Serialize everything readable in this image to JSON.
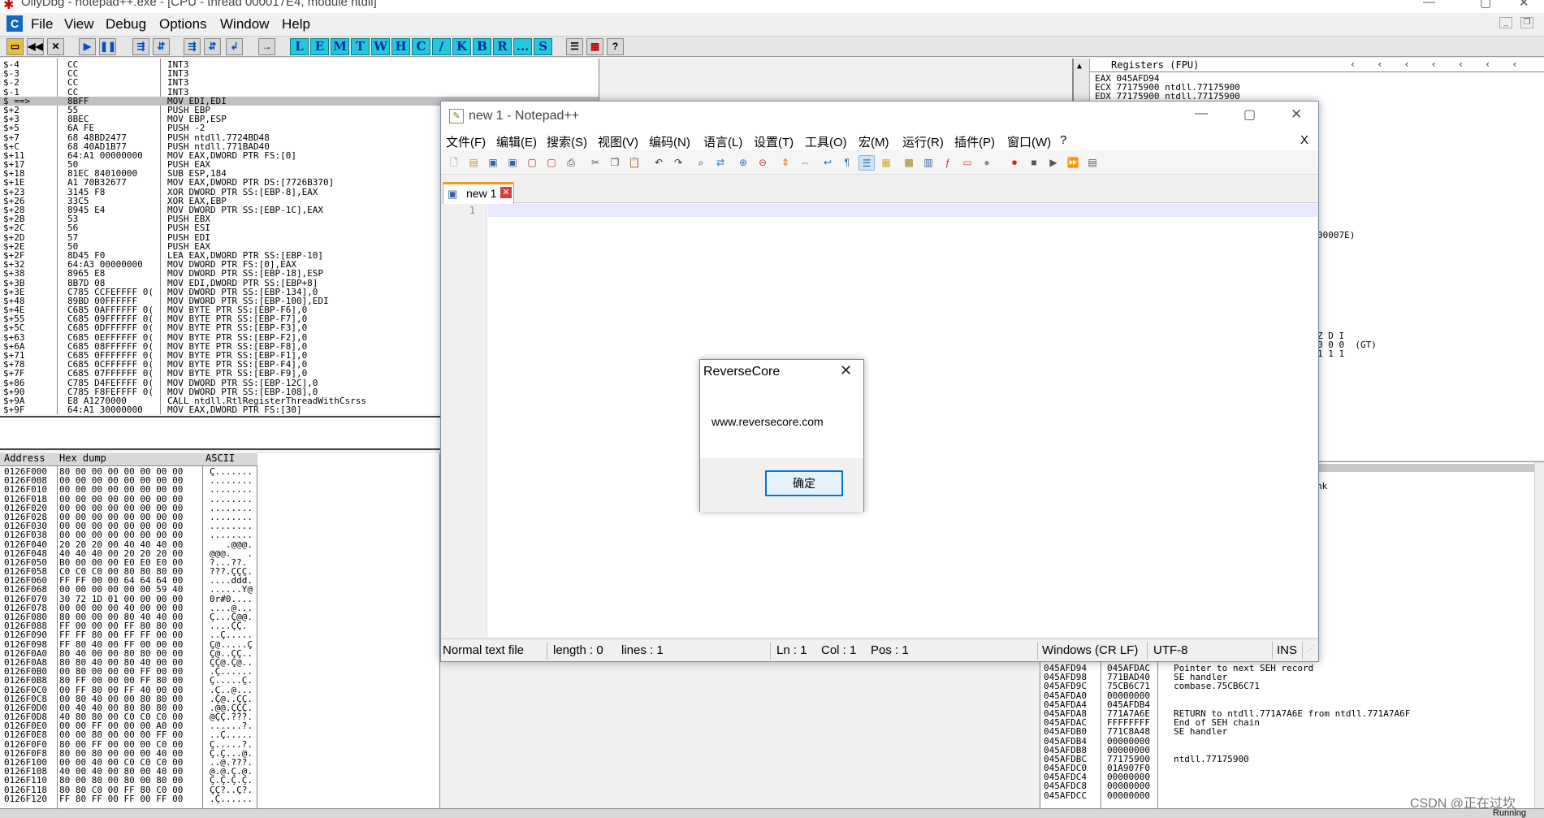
{
  "olly": {
    "title": "OllyDbg - notepad++.exe - [CPU - thread 000017E4, module ntdll]",
    "menu": [
      "File",
      "View",
      "Debug",
      "Options",
      "Window",
      "Help"
    ],
    "toolbar_letters": [
      "L",
      "E",
      "M",
      "T",
      "W",
      "H",
      "C",
      "/",
      "K",
      "B",
      "R",
      "...",
      "S"
    ],
    "registers_header": "Registers (FPU)",
    "registers": [
      "EAX 045AFD94",
      "ECX 77175900 ntdll.77175900",
      "EDX 77175900 ntdll.77175900"
    ],
    "register_fragments": {
      "r1": "00007E)",
      "r2": "Z D I",
      "r3": "0 0 0  (GT)",
      "r4": "1 1 1"
    },
    "stack_fragment": "nk",
    "status_right": "Running",
    "watermark": "CSDN @正在过坎",
    "disasm": [
      [
        "$-4",
        "CC",
        "INT3"
      ],
      [
        "$-3",
        "CC",
        "INT3"
      ],
      [
        "$-2",
        "CC",
        "INT3"
      ],
      [
        "$-1",
        "CC",
        "INT3"
      ],
      [
        "$ ==>",
        "8BFF",
        "MOV EDI,EDI"
      ],
      [
        "$+2",
        "55",
        "PUSH EBP"
      ],
      [
        "$+3",
        "8BEC",
        "MOV EBP,ESP"
      ],
      [
        "$+5",
        "6A FE",
        "PUSH -2"
      ],
      [
        "$+7",
        "68 48BD2477",
        "PUSH ntdll.7724BD48"
      ],
      [
        "$+C",
        "68 40AD1B77",
        "PUSH ntdll.771BAD40"
      ],
      [
        "$+11",
        "64:A1 00000000",
        "MOV EAX,DWORD PTR FS:[0]"
      ],
      [
        "$+17",
        "50",
        "PUSH EAX"
      ],
      [
        "$+18",
        "81EC 84010000",
        "SUB ESP,184"
      ],
      [
        "$+1E",
        "A1 70B32677",
        "MOV EAX,DWORD PTR DS:[7726B370]"
      ],
      [
        "$+23",
        "3145 F8",
        "XOR DWORD PTR SS:[EBP-8],EAX"
      ],
      [
        "$+26",
        "33C5",
        "XOR EAX,EBP"
      ],
      [
        "$+28",
        "8945 E4",
        "MOV DWORD PTR SS:[EBP-1C],EAX"
      ],
      [
        "$+2B",
        "53",
        "PUSH EBX"
      ],
      [
        "$+2C",
        "56",
        "PUSH ESI"
      ],
      [
        "$+2D",
        "57",
        "PUSH EDI"
      ],
      [
        "$+2E",
        "50",
        "PUSH EAX"
      ],
      [
        "$+2F",
        "8D45 F0",
        "LEA EAX,DWORD PTR SS:[EBP-10]"
      ],
      [
        "$+32",
        "64:A3 00000000",
        "MOV DWORD PTR FS:[0],EAX"
      ],
      [
        "$+38",
        "8965 E8",
        "MOV DWORD PTR SS:[EBP-18],ESP"
      ],
      [
        "$+3B",
        "8B7D 08",
        "MOV EDI,DWORD PTR SS:[EBP+8]"
      ],
      [
        "$+3E",
        "C785 CCFEFFFF 0(",
        "MOV DWORD PTR SS:[EBP-134],0"
      ],
      [
        "$+48",
        "89BD 00FFFFFF",
        "MOV DWORD PTR SS:[EBP-100],EDI"
      ],
      [
        "$+4E",
        "C685 0AFFFFFF 0(",
        "MOV BYTE PTR SS:[EBP-F6],0"
      ],
      [
        "$+55",
        "C685 09FFFFFF 0(",
        "MOV BYTE PTR SS:[EBP-F7],0"
      ],
      [
        "$+5C",
        "C685 0DFFFFFF 0(",
        "MOV BYTE PTR SS:[EBP-F3],0"
      ],
      [
        "$+63",
        "C685 0EFFFFFF 0(",
        "MOV BYTE PTR SS:[EBP-F2],0"
      ],
      [
        "$+6A",
        "C685 08FFFFFF 0(",
        "MOV BYTE PTR SS:[EBP-F8],0"
      ],
      [
        "$+71",
        "C685 0FFFFFFF 0(",
        "MOV BYTE PTR SS:[EBP-F1],0"
      ],
      [
        "$+78",
        "C685 0CFFFFFF 0(",
        "MOV BYTE PTR SS:[EBP-F4],0"
      ],
      [
        "$+7F",
        "C685 07FFFFFF 0(",
        "MOV BYTE PTR SS:[EBP-F9],0"
      ],
      [
        "$+86",
        "C785 D4FEFFFF 0(",
        "MOV DWORD PTR SS:[EBP-12C],0"
      ],
      [
        "$+90",
        "C785 F8FEFFFF 0(",
        "MOV DWORD PTR SS:[EBP-108],0"
      ],
      [
        "$+9A",
        "E8 A1270000",
        "CALL ntdll.RtlRegisterThreadWithCsrss"
      ],
      [
        "$+9F",
        "64:A1 30000000",
        "MOV EAX,DWORD PTR FS:[30]"
      ]
    ],
    "dump_headers": {
      "address": "Address",
      "hex": "Hex dump",
      "ascii": "ASCII"
    },
    "dump": [
      [
        "0126F000",
        "80 00 00 00 00 00 00 00",
        "Ç......."
      ],
      [
        "0126F008",
        "00 00 00 00 00 00 00 00",
        "........"
      ],
      [
        "0126F010",
        "00 00 00 00 00 00 00 00",
        "........"
      ],
      [
        "0126F018",
        "00 00 00 00 00 00 00 00",
        "........"
      ],
      [
        "0126F020",
        "00 00 00 00 00 00 00 00",
        "........"
      ],
      [
        "0126F028",
        "00 00 00 00 00 00 00 00",
        "........"
      ],
      [
        "0126F030",
        "00 00 00 00 00 00 00 00",
        "........"
      ],
      [
        "0126F038",
        "00 00 00 00 00 00 00 00",
        "........"
      ],
      [
        "0126F040",
        "20 20 20 00 40 40 40 00",
        "   .@@@."
      ],
      [
        "0126F048",
        "40 40 40 00 20 20 20 00",
        "@@@.   ."
      ],
      [
        "0126F050",
        "B0 00 00 00 E0 E0 E0 00",
        "?...??."
      ],
      [
        "0126F058",
        "C0 C0 C0 00 80 80 80 00",
        "???.ÇÇÇ."
      ],
      [
        "0126F060",
        "FF FF 00 00 64 64 64 00",
        "....ddd."
      ],
      [
        "0126F068",
        "00 00 00 00 00 00 59 40",
        "......Y@"
      ],
      [
        "0126F070",
        "30 72 1D 01 00 00 00 00",
        "0r#0...."
      ],
      [
        "0126F078",
        "00 00 00 00 40 00 00 00",
        "....@..."
      ],
      [
        "0126F080",
        "80 00 00 00 80 40 40 00",
        "Ç...Ç@@."
      ],
      [
        "0126F088",
        "FF 00 00 00 FF 80 80 00",
        "....ÇÇ."
      ],
      [
        "0126F090",
        "FF FF 80 00 FF FF 00 00",
        "..Ç....."
      ],
      [
        "0126F098",
        "FF 80 40 00 FF 00 00 00",
        "Ç@.....Ç"
      ],
      [
        "0126F0A0",
        "80 40 00 00 80 80 00 00",
        "Ç@..ÇÇ.."
      ],
      [
        "0126F0A8",
        "80 80 40 00 80 40 00 00",
        "ÇÇ@.Ç@.."
      ],
      [
        "0126F0B0",
        "00 80 00 00 00 FF 00 00",
        ".Ç......"
      ],
      [
        "0126F0B8",
        "80 FF 00 00 00 FF 80 00",
        "Ç.....Ç."
      ],
      [
        "0126F0C0",
        "00 FF 80 00 FF 40 00 00",
        ".Ç..@..."
      ],
      [
        "0126F0C8",
        "00 80 40 00 00 80 80 00",
        ".Ç@..ÇÇ."
      ],
      [
        "0126F0D0",
        "00 40 40 00 80 80 80 00",
        ".@@.ÇÇÇ."
      ],
      [
        "0126F0D8",
        "40 80 80 00 C0 C0 C0 00",
        "@ÇÇ.???."
      ],
      [
        "0126F0E0",
        "00 00 FF 00 00 00 A0 00",
        "......?."
      ],
      [
        "0126F0E8",
        "00 00 80 00 00 00 FF 00",
        "..Ç....."
      ],
      [
        "0126F0F0",
        "80 00 FF 00 00 00 C0 00",
        "Ç.....?."
      ],
      [
        "0126F0F8",
        "80 00 80 00 00 00 40 00",
        "Ç.Ç...@."
      ],
      [
        "0126F100",
        "00 00 40 00 C0 C0 C0 00",
        "..@.???."
      ],
      [
        "0126F108",
        "40 00 40 00 80 00 40 00",
        "@.@.Ç.@."
      ],
      [
        "0126F110",
        "80 00 80 00 80 00 80 00",
        "Ç.Ç.Ç.Ç."
      ],
      [
        "0126F118",
        "80 80 C0 00 FF 80 C0 00",
        "ÇÇ?..Ç?."
      ],
      [
        "0126F120",
        "FF 80 FF 00 FF 00 FF 00",
        ".Ç......"
      ]
    ],
    "stack": [
      [
        "045AFD94",
        "045AFDAC",
        "Pointer to next SEH record"
      ],
      [
        "045AFD98",
        "771BAD40",
        "SE handler"
      ],
      [
        "045AFD9C",
        "75CB6C71",
        "combase.75CB6C71"
      ],
      [
        "045AFDA0",
        "00000000",
        ""
      ],
      [
        "045AFDA4",
        "045AFDB4",
        ""
      ],
      [
        "045AFDA8",
        "771A7A6E",
        "RETURN to ntdll.771A7A6E from ntdll.771A7A6F"
      ],
      [
        "045AFDAC",
        "FFFFFFFF",
        "End of SEH chain"
      ],
      [
        "045AFDB0",
        "771C8A48",
        "SE handler"
      ],
      [
        "045AFDB4",
        "00000000",
        ""
      ],
      [
        "045AFDB8",
        "00000000",
        ""
      ],
      [
        "045AFDBC",
        "77175900",
        "ntdll.77175900"
      ],
      [
        "045AFDC0",
        "01A907F0",
        ""
      ],
      [
        "045AFDC4",
        "00000000",
        ""
      ],
      [
        "045AFDC8",
        "00000000",
        ""
      ],
      [
        "045AFDCC",
        "00000000",
        ""
      ]
    ]
  },
  "npp": {
    "title": "new 1 - Notepad++",
    "menu": [
      "文件(F)",
      "编辑(E)",
      "搜索(S)",
      "视图(V)",
      "编码(N)",
      "语言(L)",
      "设置(T)",
      "工具(O)",
      "宏(M)",
      "运行(R)",
      "插件(P)",
      "窗口(W)",
      "?"
    ],
    "close_x": "X",
    "tab_label": "new 1",
    "line_number": "1",
    "status": {
      "type": "Normal text file",
      "length": "length : 0",
      "lines": "lines : 1",
      "ln": "Ln : 1",
      "col": "Col : 1",
      "pos": "Pos : 1",
      "eol": "Windows (CR LF)",
      "encoding": "UTF-8",
      "mode": "INS"
    }
  },
  "dialog": {
    "title": "ReverseCore",
    "message": "www.reversecore.com",
    "ok_label": "确定"
  },
  "colors": {
    "accent": "#0078d7",
    "olly_toolbar_letter": "#24c8d8",
    "tab_accent": "#f39b1d"
  }
}
